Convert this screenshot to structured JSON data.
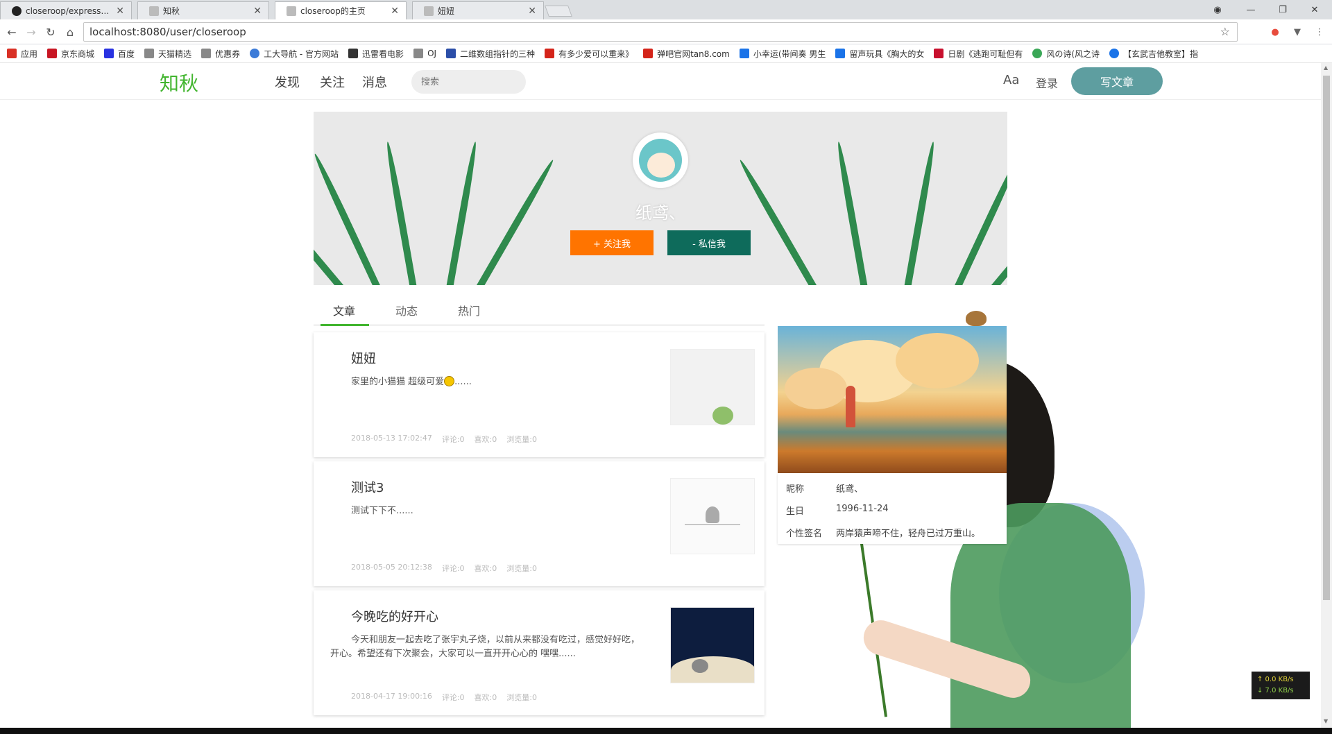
{
  "browser": {
    "tabs": [
      {
        "title": "closeroop/express-stor",
        "icon": "github-icon",
        "active": false
      },
      {
        "title": "知秋",
        "icon": "page-icon",
        "active": false
      },
      {
        "title": "closeroop的主页",
        "icon": "page-icon",
        "active": true
      },
      {
        "title": "妞妞",
        "icon": "page-icon",
        "active": false
      }
    ],
    "url": "localhost:8080/user/closeroop",
    "bookmarks": [
      {
        "label": "应用",
        "color": "#d93025"
      },
      {
        "label": "京东商城",
        "color": "#c81623"
      },
      {
        "label": "百度",
        "color": "#2932e1"
      },
      {
        "label": "天猫精选",
        "color": "#888888"
      },
      {
        "label": "优惠券",
        "color": "#888888"
      },
      {
        "label": "工大导航 - 官方网站",
        "color": "#3c7bd8"
      },
      {
        "label": "迅雷看电影",
        "color": "#333333"
      },
      {
        "label": "OJ",
        "color": "#888888"
      },
      {
        "label": "二维数组指针的三种",
        "color": "#2b4ea8"
      },
      {
        "label": "有多少爱可以重来》",
        "color": "#d4241a"
      },
      {
        "label": "弹吧官网tan8.com",
        "color": "#d4241a"
      },
      {
        "label": "小幸运(带间奏 男生",
        "color": "#1a73e8"
      },
      {
        "label": "留声玩具《胸大的女",
        "color": "#1a73e8"
      },
      {
        "label": "日剧《逃跑可耻但有",
        "color": "#c8102e"
      },
      {
        "label": "风の诗(风之诗",
        "color": "#3aa757"
      },
      {
        "label": "【玄武吉他教室】指",
        "color": "#1a73e8"
      }
    ]
  },
  "site": {
    "logo": "知秋",
    "nav": [
      "发现",
      "关注",
      "消息"
    ],
    "search_placeholder": "搜索",
    "font_toggle": "Aa",
    "login": "登录",
    "write": "写文章",
    "accent": "#42b52f"
  },
  "profile": {
    "name": "纸鸢、",
    "follow_label": "+ 关注我",
    "message_label": "- 私信我",
    "tabs": [
      "文章",
      "动态",
      "热门"
    ]
  },
  "articles": [
    {
      "title": "妞妞",
      "excerpt": "家里的小猫猫 超级可爱",
      "excerpt_suffix": "......",
      "date": "2018-05-13 17:02:47",
      "comments": "评论:0",
      "likes": "喜欢:0",
      "views": "浏览量:0"
    },
    {
      "title": "测试3",
      "excerpt": "测试下下不......",
      "date": "2018-05-05 20:12:38",
      "comments": "评论:0",
      "likes": "喜欢:0",
      "views": "浏览量:0"
    },
    {
      "title": "今晚吃的好开心",
      "excerpt": "今天和朋友一起去吃了张宇丸子烧，以前从来都没有吃过，感觉好好吃，开心。希望还有下次聚会，大家可以一直开开心心的 嘿嘿......",
      "date": "2018-04-17 19:00:16",
      "comments": "评论:0",
      "likes": "喜欢:0",
      "views": "浏览量:0"
    }
  ],
  "info": {
    "rows": [
      {
        "key": "昵称",
        "value": "纸鸢、"
      },
      {
        "key": "生日",
        "value": "1996-11-24"
      },
      {
        "key": "个性签名",
        "value": "两岸猿声啼不住，轻舟已过万重山。"
      }
    ]
  },
  "netmon": {
    "up": "↑ 0.0 KB/s",
    "down": "↓ 7.0 KB/s"
  }
}
